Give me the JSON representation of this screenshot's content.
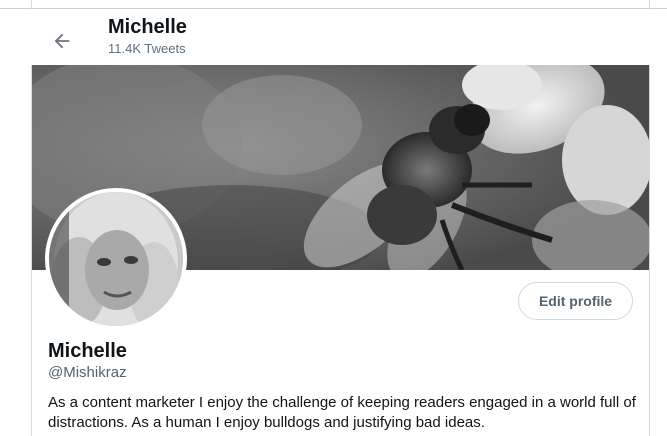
{
  "header": {
    "back_icon": "arrow-left-icon",
    "title": "Michelle",
    "tweet_count": "11.4K Tweets"
  },
  "banner": {
    "description_icon": "banner-image"
  },
  "profile": {
    "avatar_icon": "avatar",
    "edit_profile_label": "Edit profile",
    "display_name": "Michelle",
    "handle": "@Mishikraz",
    "bio": "As a content marketer I enjoy the challenge of keeping readers engaged in a world full of distractions. As a human I enjoy bulldogs and justifying bad ideas."
  },
  "colors": {
    "text_primary": "#0f1419",
    "text_secondary": "#536471",
    "border": "#cfd9de"
  }
}
